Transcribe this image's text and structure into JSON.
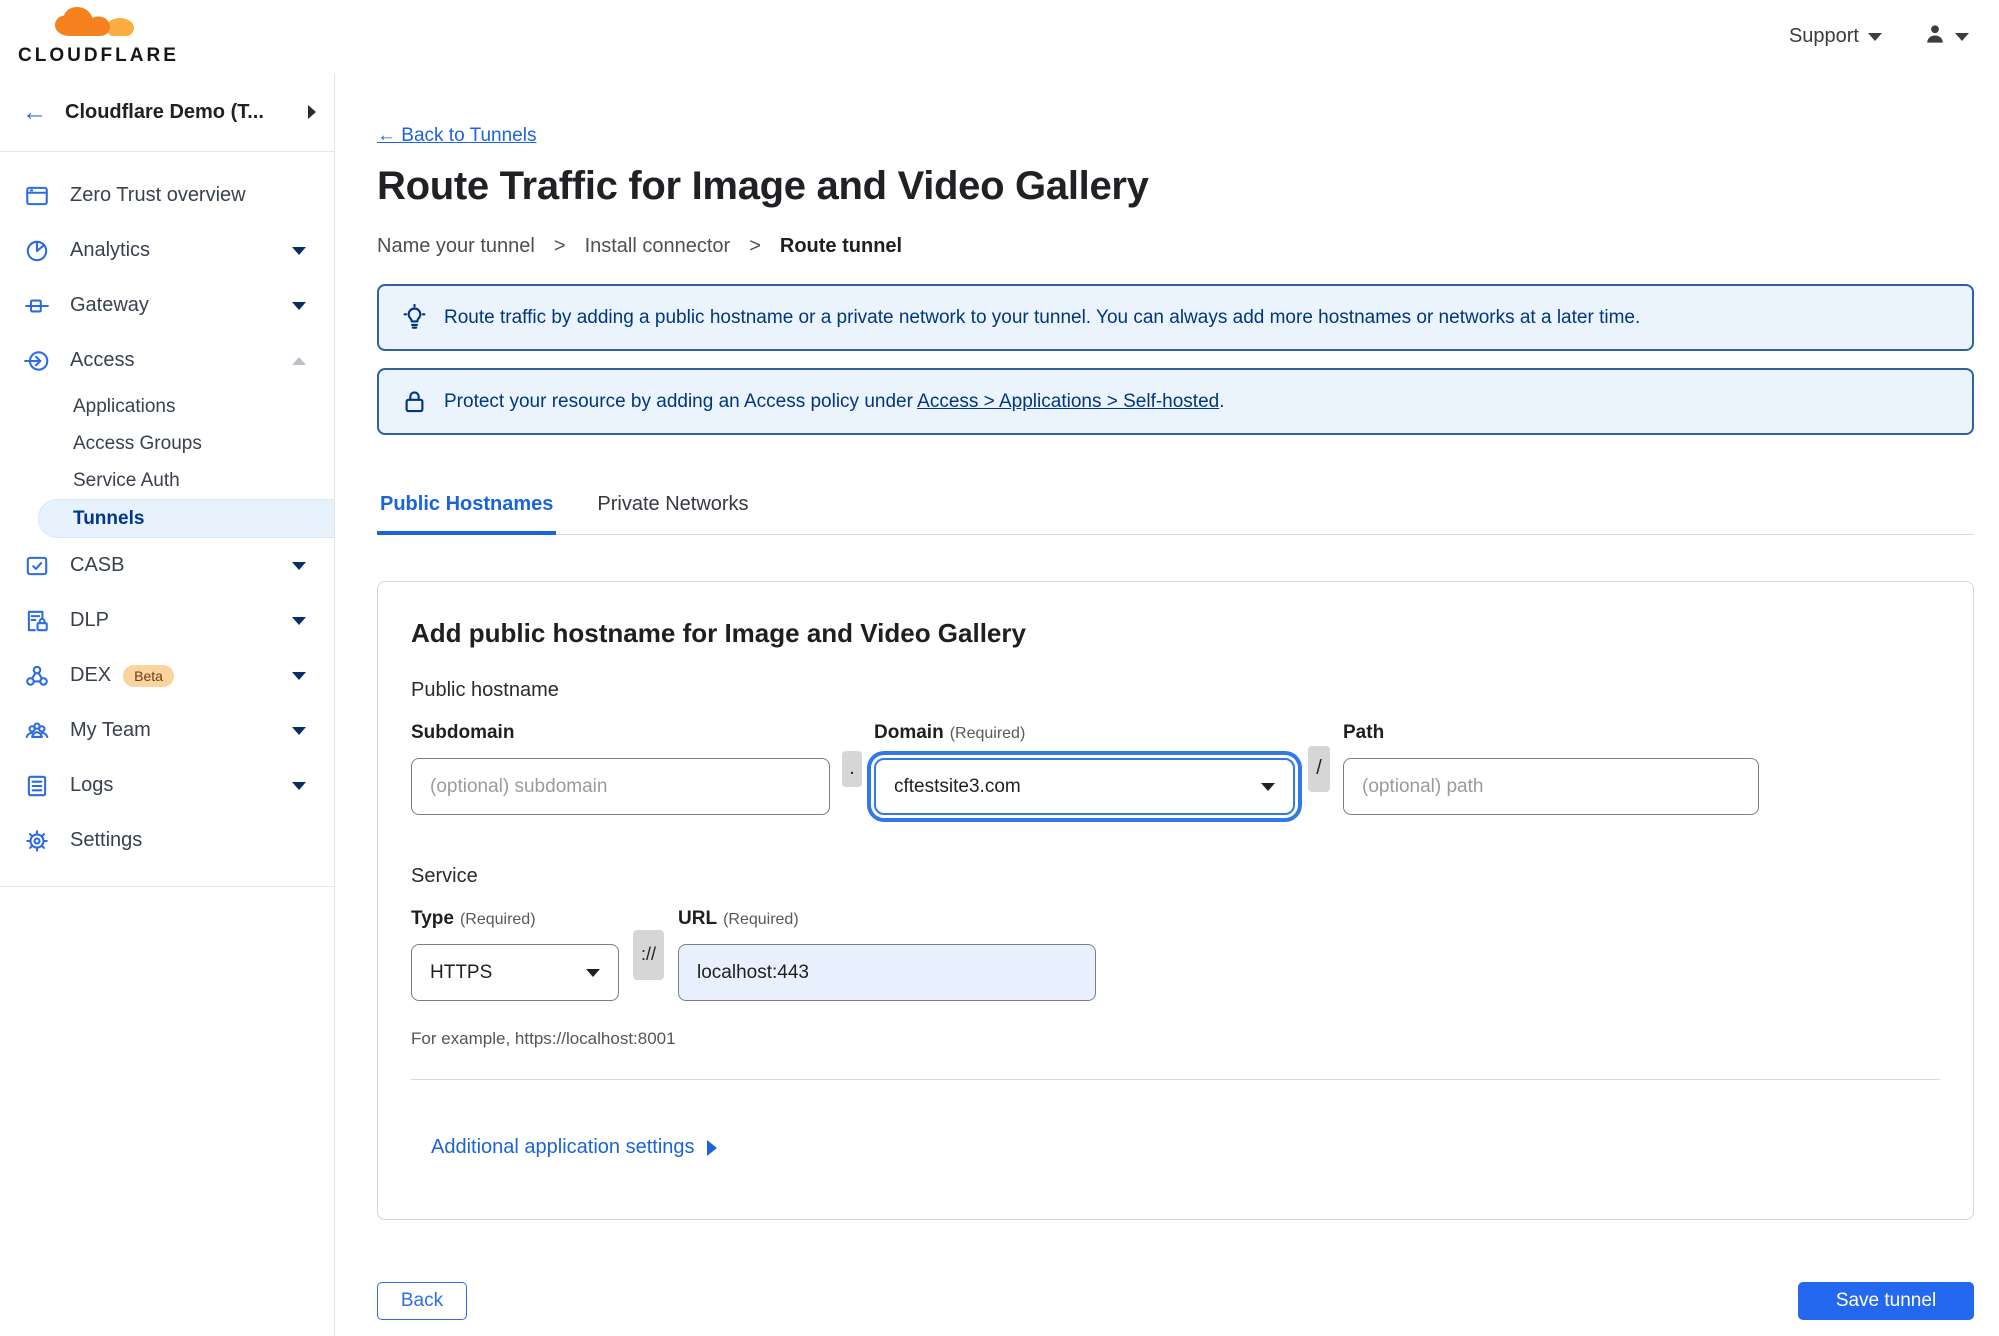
{
  "topbar": {
    "brand": "CLOUDFLARE",
    "support_label": "Support"
  },
  "sidebar": {
    "team_name": "Cloudflare Demo (T...",
    "items": [
      {
        "id": "zero-trust-overview",
        "label": "Zero Trust overview"
      },
      {
        "id": "analytics",
        "label": "Analytics",
        "caret": "down"
      },
      {
        "id": "gateway",
        "label": "Gateway",
        "caret": "down"
      },
      {
        "id": "access",
        "label": "Access",
        "caret": "up",
        "expanded": true,
        "children": [
          {
            "label": "Applications"
          },
          {
            "label": "Access Groups"
          },
          {
            "label": "Service Auth"
          },
          {
            "label": "Tunnels",
            "selected": true
          }
        ]
      },
      {
        "id": "casb",
        "label": "CASB",
        "caret": "down"
      },
      {
        "id": "dlp",
        "label": "DLP",
        "caret": "down"
      },
      {
        "id": "dex",
        "label": "DEX",
        "badge": "Beta",
        "caret": "down"
      },
      {
        "id": "my-team",
        "label": "My Team",
        "caret": "down"
      },
      {
        "id": "logs",
        "label": "Logs",
        "caret": "down"
      },
      {
        "id": "settings",
        "label": "Settings"
      }
    ]
  },
  "main": {
    "back_link": "← Back to Tunnels",
    "title": "Route Traffic for Image and Video Gallery",
    "steps_separator": ">",
    "steps": [
      {
        "label": "Name your tunnel"
      },
      {
        "label": "Install connector"
      },
      {
        "label": "Route tunnel",
        "current": true
      }
    ],
    "banners": [
      {
        "icon": "lightbulb-icon",
        "text": "Route traffic by adding a public hostname or a private network to your tunnel. You can always add more hostnames or networks at a later time."
      },
      {
        "icon": "lock-icon",
        "text_before": "Protect your resource by adding an Access policy under ",
        "link_text": "Access > Applications > Self-hosted",
        "text_after": "."
      }
    ],
    "tabs": [
      {
        "label": "Public Hostnames",
        "active": true
      },
      {
        "label": "Private Networks",
        "active": false
      }
    ],
    "form": {
      "heading": "Add public hostname for Image and Video Gallery",
      "section_public_hostname": "Public hostname",
      "subdomain": {
        "label": "Subdomain",
        "placeholder": "(optional) subdomain",
        "value": ""
      },
      "dot_separator": ".",
      "domain": {
        "label": "Domain",
        "required_hint": "(Required)",
        "value": "cftestsite3.com",
        "focused": true
      },
      "slash_separator": "/",
      "path": {
        "label": "Path",
        "placeholder": "(optional) path",
        "value": ""
      },
      "section_service": "Service",
      "type": {
        "label": "Type",
        "required_hint": "(Required)",
        "value": "HTTPS"
      },
      "scheme_separator": "://",
      "url": {
        "label": "URL",
        "required_hint": "(Required)",
        "value": "localhost:443"
      },
      "example_hint": "For example, https://localhost:8001",
      "additional_settings": "Additional application settings"
    },
    "footer": {
      "back_label": "Back",
      "save_label": "Save tunnel"
    }
  },
  "colors": {
    "accent_blue": "#2468f0",
    "link_blue": "#1e63d9",
    "info_navy": "#003681",
    "icon_blue": "#2c6be0",
    "banner_bg": "#ebf4fc",
    "banner_border": "#30609f",
    "selected_item_bg": "#e8f2fc",
    "beta_badge_bg": "#fbd39d",
    "logo_orange": "#f6821f",
    "logo_orange_light": "#fbad41",
    "url_autofill_bg": "#e8f0fe"
  }
}
